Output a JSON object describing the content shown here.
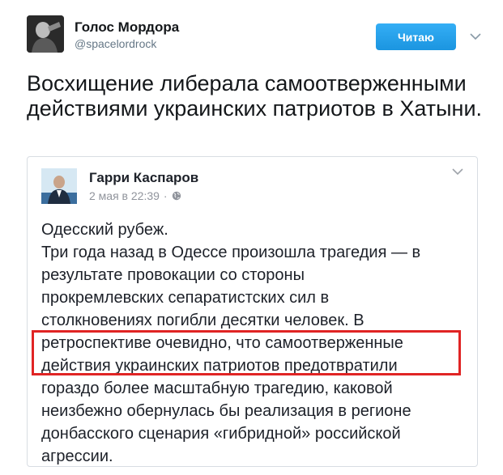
{
  "tweet": {
    "author_name": "Голос Мордора",
    "author_handle": "@spacelordrock",
    "follow_label": "Читаю",
    "text": "Восхищение либерала самоотверженными действиями украинских патриотов в Хатыни."
  },
  "embedded_post": {
    "author": "Гарри Каспаров",
    "date": "2 мая в 22:39",
    "separator": "·",
    "icon": "globe-icon",
    "lines": [
      "Одесский рубеж.",
      "Три года назад в Одессе произошла трагедия — в",
      "результате провокации со стороны",
      "прокремлевских сепаратистских сил в",
      "столкновениях погибли десятки человек. В",
      "ретроспективе очевидно, что самоотверженные",
      "действия украинских патриотов предотвратили",
      "гораздо более масштабную трагедию, каковой",
      "неизбежно обернулась бы реализация в регионе",
      "донбасского сценария «гибридной» российской",
      "агрессии."
    ]
  },
  "colors": {
    "follow_button": "#1da1f2",
    "highlight": "#e02424"
  }
}
